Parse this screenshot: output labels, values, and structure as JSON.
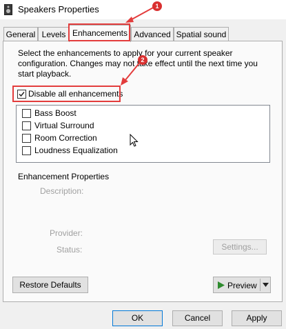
{
  "window": {
    "title": "Speakers Properties"
  },
  "tabs": [
    "General",
    "Levels",
    "Enhancements",
    "Advanced",
    "Spatial sound"
  ],
  "intro_text": "Select the enhancements to apply for your current speaker configuration. Changes may not take effect until the next time you start playback.",
  "disable_all": {
    "label": "Disable all enhancements",
    "checked": true
  },
  "enhancements": [
    "Bass Boost",
    "Virtual Surround",
    "Room Correction",
    "Loudness Equalization"
  ],
  "properties": {
    "heading": "Enhancement Properties",
    "description_label": "Description:",
    "provider_label": "Provider:",
    "status_label": "Status:",
    "settings_button": "Settings..."
  },
  "buttons": {
    "restore": "Restore Defaults",
    "preview": "Preview",
    "ok": "OK",
    "cancel": "Cancel",
    "apply": "Apply"
  },
  "annotations": {
    "badge_1": "1",
    "badge_2": "2"
  },
  "colors": {
    "annotation_red": "#e33c3c",
    "play_green": "#2e8b2e"
  }
}
